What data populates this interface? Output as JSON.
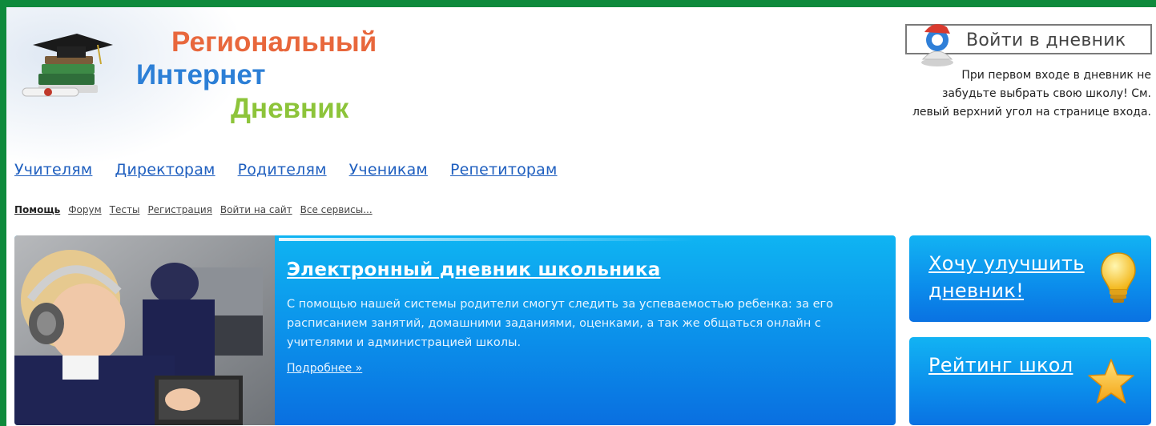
{
  "logo": {
    "line1": "Региональный",
    "line2": "Интернет",
    "line3": "Дневник"
  },
  "login": {
    "button_label": "Войти в дневник",
    "note": "При первом входе в дневник не забудьте выбрать свою школу! См. левый верхний угол на странице входа."
  },
  "main_nav": [
    "Учителям",
    "Директорам",
    "Родителям",
    "Ученикам",
    "Репетиторам"
  ],
  "sub_nav": [
    "Помощь",
    "Форум",
    "Тесты",
    "Регистрация",
    "Войти на сайт",
    "Все сервисы..."
  ],
  "banner": {
    "title": "Электронный дневник школьника",
    "text": "С помощью нашей системы родители смогут следить за успеваемостью ребенка: за его расписанием занятий, домашними заданиями, оценками, а так же общаться онлайн с учителями и администрацией школы.",
    "more_link": "Подробнее »"
  },
  "side_cards": [
    {
      "label": "Хочу улучшить дневник!",
      "icon": "lightbulb-icon"
    },
    {
      "label": "Рейтинг школ",
      "icon": "star-icon"
    }
  ],
  "colors": {
    "outer_border": "#0e8a3c",
    "logo_orange": "#e8673c",
    "logo_blue": "#2c7fd6",
    "logo_green": "#8dc43a",
    "nav_link": "#1f5fbf",
    "banner_blue": "#0b8fea"
  }
}
